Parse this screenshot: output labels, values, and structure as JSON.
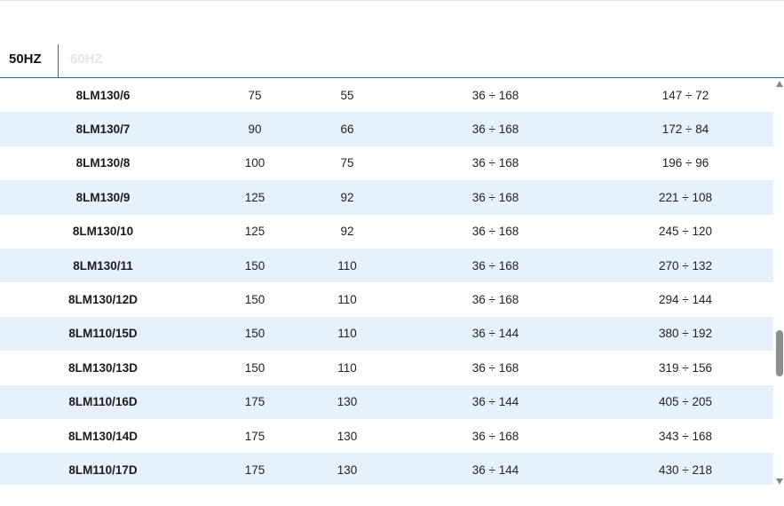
{
  "tabs": [
    {
      "label": "50HZ",
      "active": true
    },
    {
      "label": "60HZ",
      "active": false
    }
  ],
  "rows": [
    [
      "8LM130/6",
      "75",
      "55",
      "36 ÷ 168",
      "147 ÷ 72"
    ],
    [
      "8LM130/7",
      "90",
      "66",
      "36 ÷ 168",
      "172 ÷ 84"
    ],
    [
      "8LM130/8",
      "100",
      "75",
      "36 ÷ 168",
      "196 ÷ 96"
    ],
    [
      "8LM130/9",
      "125",
      "92",
      "36 ÷ 168",
      "221 ÷ 108"
    ],
    [
      "8LM130/10",
      "125",
      "92",
      "36 ÷ 168",
      "245 ÷ 120"
    ],
    [
      "8LM130/11",
      "150",
      "110",
      "36 ÷ 168",
      "270 ÷ 132"
    ],
    [
      "8LM130/12D",
      "150",
      "110",
      "36 ÷ 168",
      "294 ÷ 144"
    ],
    [
      "8LM110/15D",
      "150",
      "110",
      "36 ÷ 144",
      "380 ÷ 192"
    ],
    [
      "8LM130/13D",
      "150",
      "110",
      "36 ÷ 168",
      "319 ÷ 156"
    ],
    [
      "8LM110/16D",
      "175",
      "130",
      "36 ÷ 144",
      "405 ÷ 205"
    ],
    [
      "8LM130/14D",
      "175",
      "130",
      "36 ÷ 168",
      "343 ÷ 168"
    ],
    [
      "8LM110/17D",
      "175",
      "130",
      "36 ÷ 144",
      "430 ÷ 218"
    ]
  ],
  "colors": {
    "accent": "#1a6fb0",
    "row_alt": "#e6f1fc",
    "inactive_tab": "#e2e4e8"
  },
  "scroll": {
    "position_fraction": 0.62
  }
}
